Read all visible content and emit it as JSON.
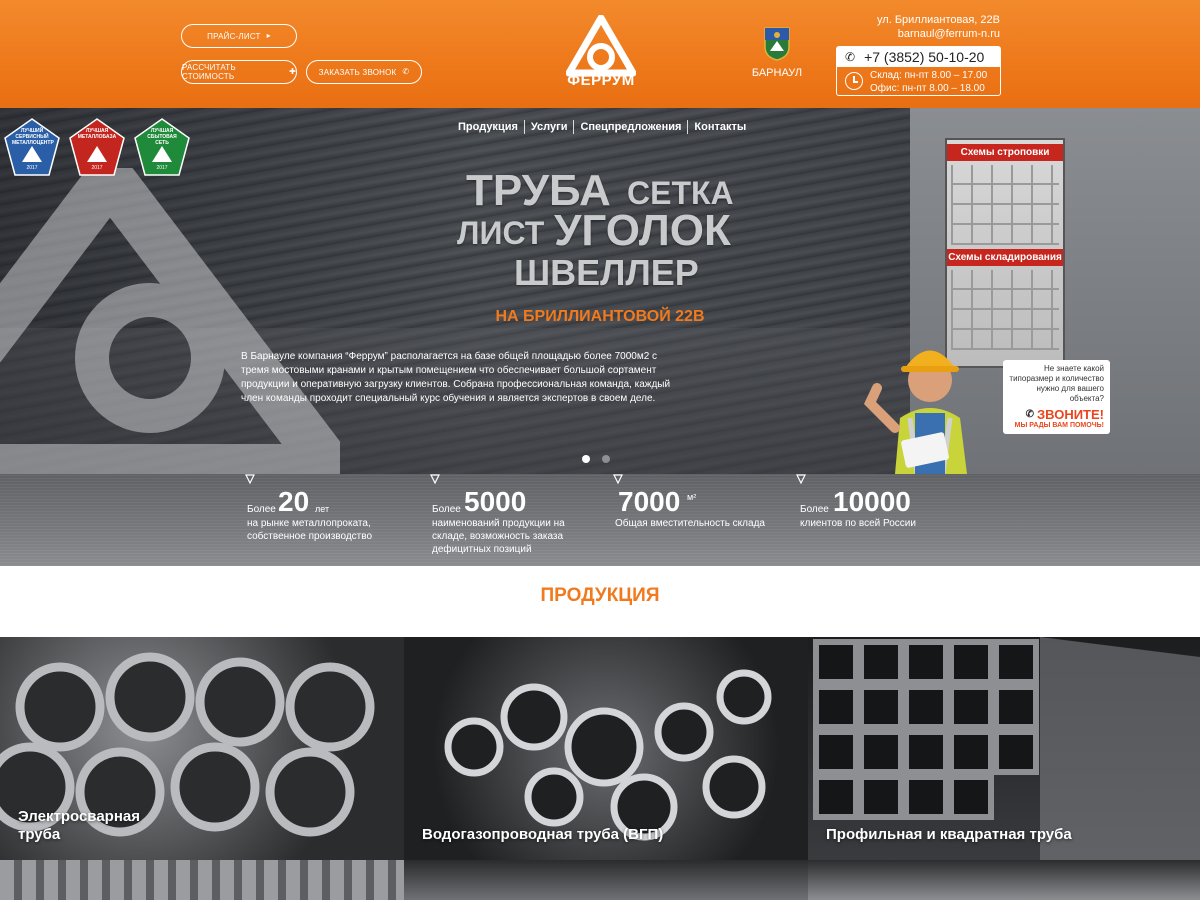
{
  "header": {
    "buttons": {
      "price_list": "ПРАЙС-ЛИСТ",
      "calculate": "РАССЧИТАТЬ СТОИМОСТЬ",
      "order_call": "ЗАКАЗАТЬ ЗВОНОК"
    },
    "logo_text": "ФЕРРУМ",
    "city": "БАРНАУЛ",
    "address": "ул. Бриллиантовая, 22В",
    "email": "barnaul@ferrum-n.ru",
    "phone": "+7 (3852) 50-10-20",
    "hours": {
      "warehouse": "Склад: пн-пт 8.00 – 17.00",
      "office": "Офис: пн-пт 8.00 – 18.00"
    },
    "colors": {
      "brand_orange": "#ee7a1c",
      "accent_orange": "#f07a1d"
    }
  },
  "nav": {
    "items": [
      "Продукция",
      "Услуги",
      "Спецпредложения",
      "Контакты"
    ]
  },
  "badges": [
    {
      "text": "ЛУЧШИЙ СЕРВИСНЫЙ МЕТАЛЛОЦЕНТР",
      "year": "2017",
      "color": "#2a5fa8"
    },
    {
      "text": "ЛУЧШАЯ МЕТАЛЛОБАЗА",
      "year": "2017",
      "color": "#c3261f"
    },
    {
      "text": "ЛУЧШАЯ СБЫТОВАЯ СЕТЬ",
      "year": "2017",
      "color": "#1f8a3a"
    }
  ],
  "hero": {
    "words": {
      "truba": "ТРУБА",
      "setka": "СЕТКА",
      "list": "ЛИСТ",
      "ugolok": "УГОЛОК",
      "shveller": "ШВЕЛЛЕР"
    },
    "subtitle": "НА БРИЛЛИАНТОВОЙ 22В",
    "description": "В Барнауле компания “Феррум” располагается на базе общей площадью более 7000м2 с тремя мостовыми кранами и крытым помещением что обеспечивает большой сортамент продукции и оперативную загрузку клиентов. Собрана профессиональная команда, каждый член команды проходит специальный курс обучения и является экспертов в своем деле.",
    "board_titles": [
      "Схемы строповки",
      "Схемы складирования"
    ],
    "callout": {
      "question": "Не знаете какой типоразмер и количество нужно для вашего объекта?",
      "cta": "ЗВОНИТЕ!",
      "sub": "МЫ РАДЫ ВАМ ПОМОЧЬ!"
    },
    "slides_count": 2,
    "active_slide": 1
  },
  "stats": [
    {
      "pre": "Более",
      "num": "20",
      "suf": "лет",
      "desc": "на рынке металлопроката, собственное производство"
    },
    {
      "pre": "Более",
      "num": "5000",
      "suf": "",
      "desc": "наименований продукции на складе, возможность заказа дефицитных позиций"
    },
    {
      "pre": "",
      "num": "7000",
      "suf": "м²",
      "desc": "Общая вместительность склада"
    },
    {
      "pre": "Более",
      "num": "10000",
      "suf": "",
      "desc": "клиентов по всей России"
    }
  ],
  "products": {
    "title": "ПРОДУКЦИЯ",
    "items": [
      {
        "label": "Электросварная труба"
      },
      {
        "label": "Водогазопроводная труба (ВГП)"
      },
      {
        "label": "Профильная и квадратная труба"
      }
    ]
  }
}
